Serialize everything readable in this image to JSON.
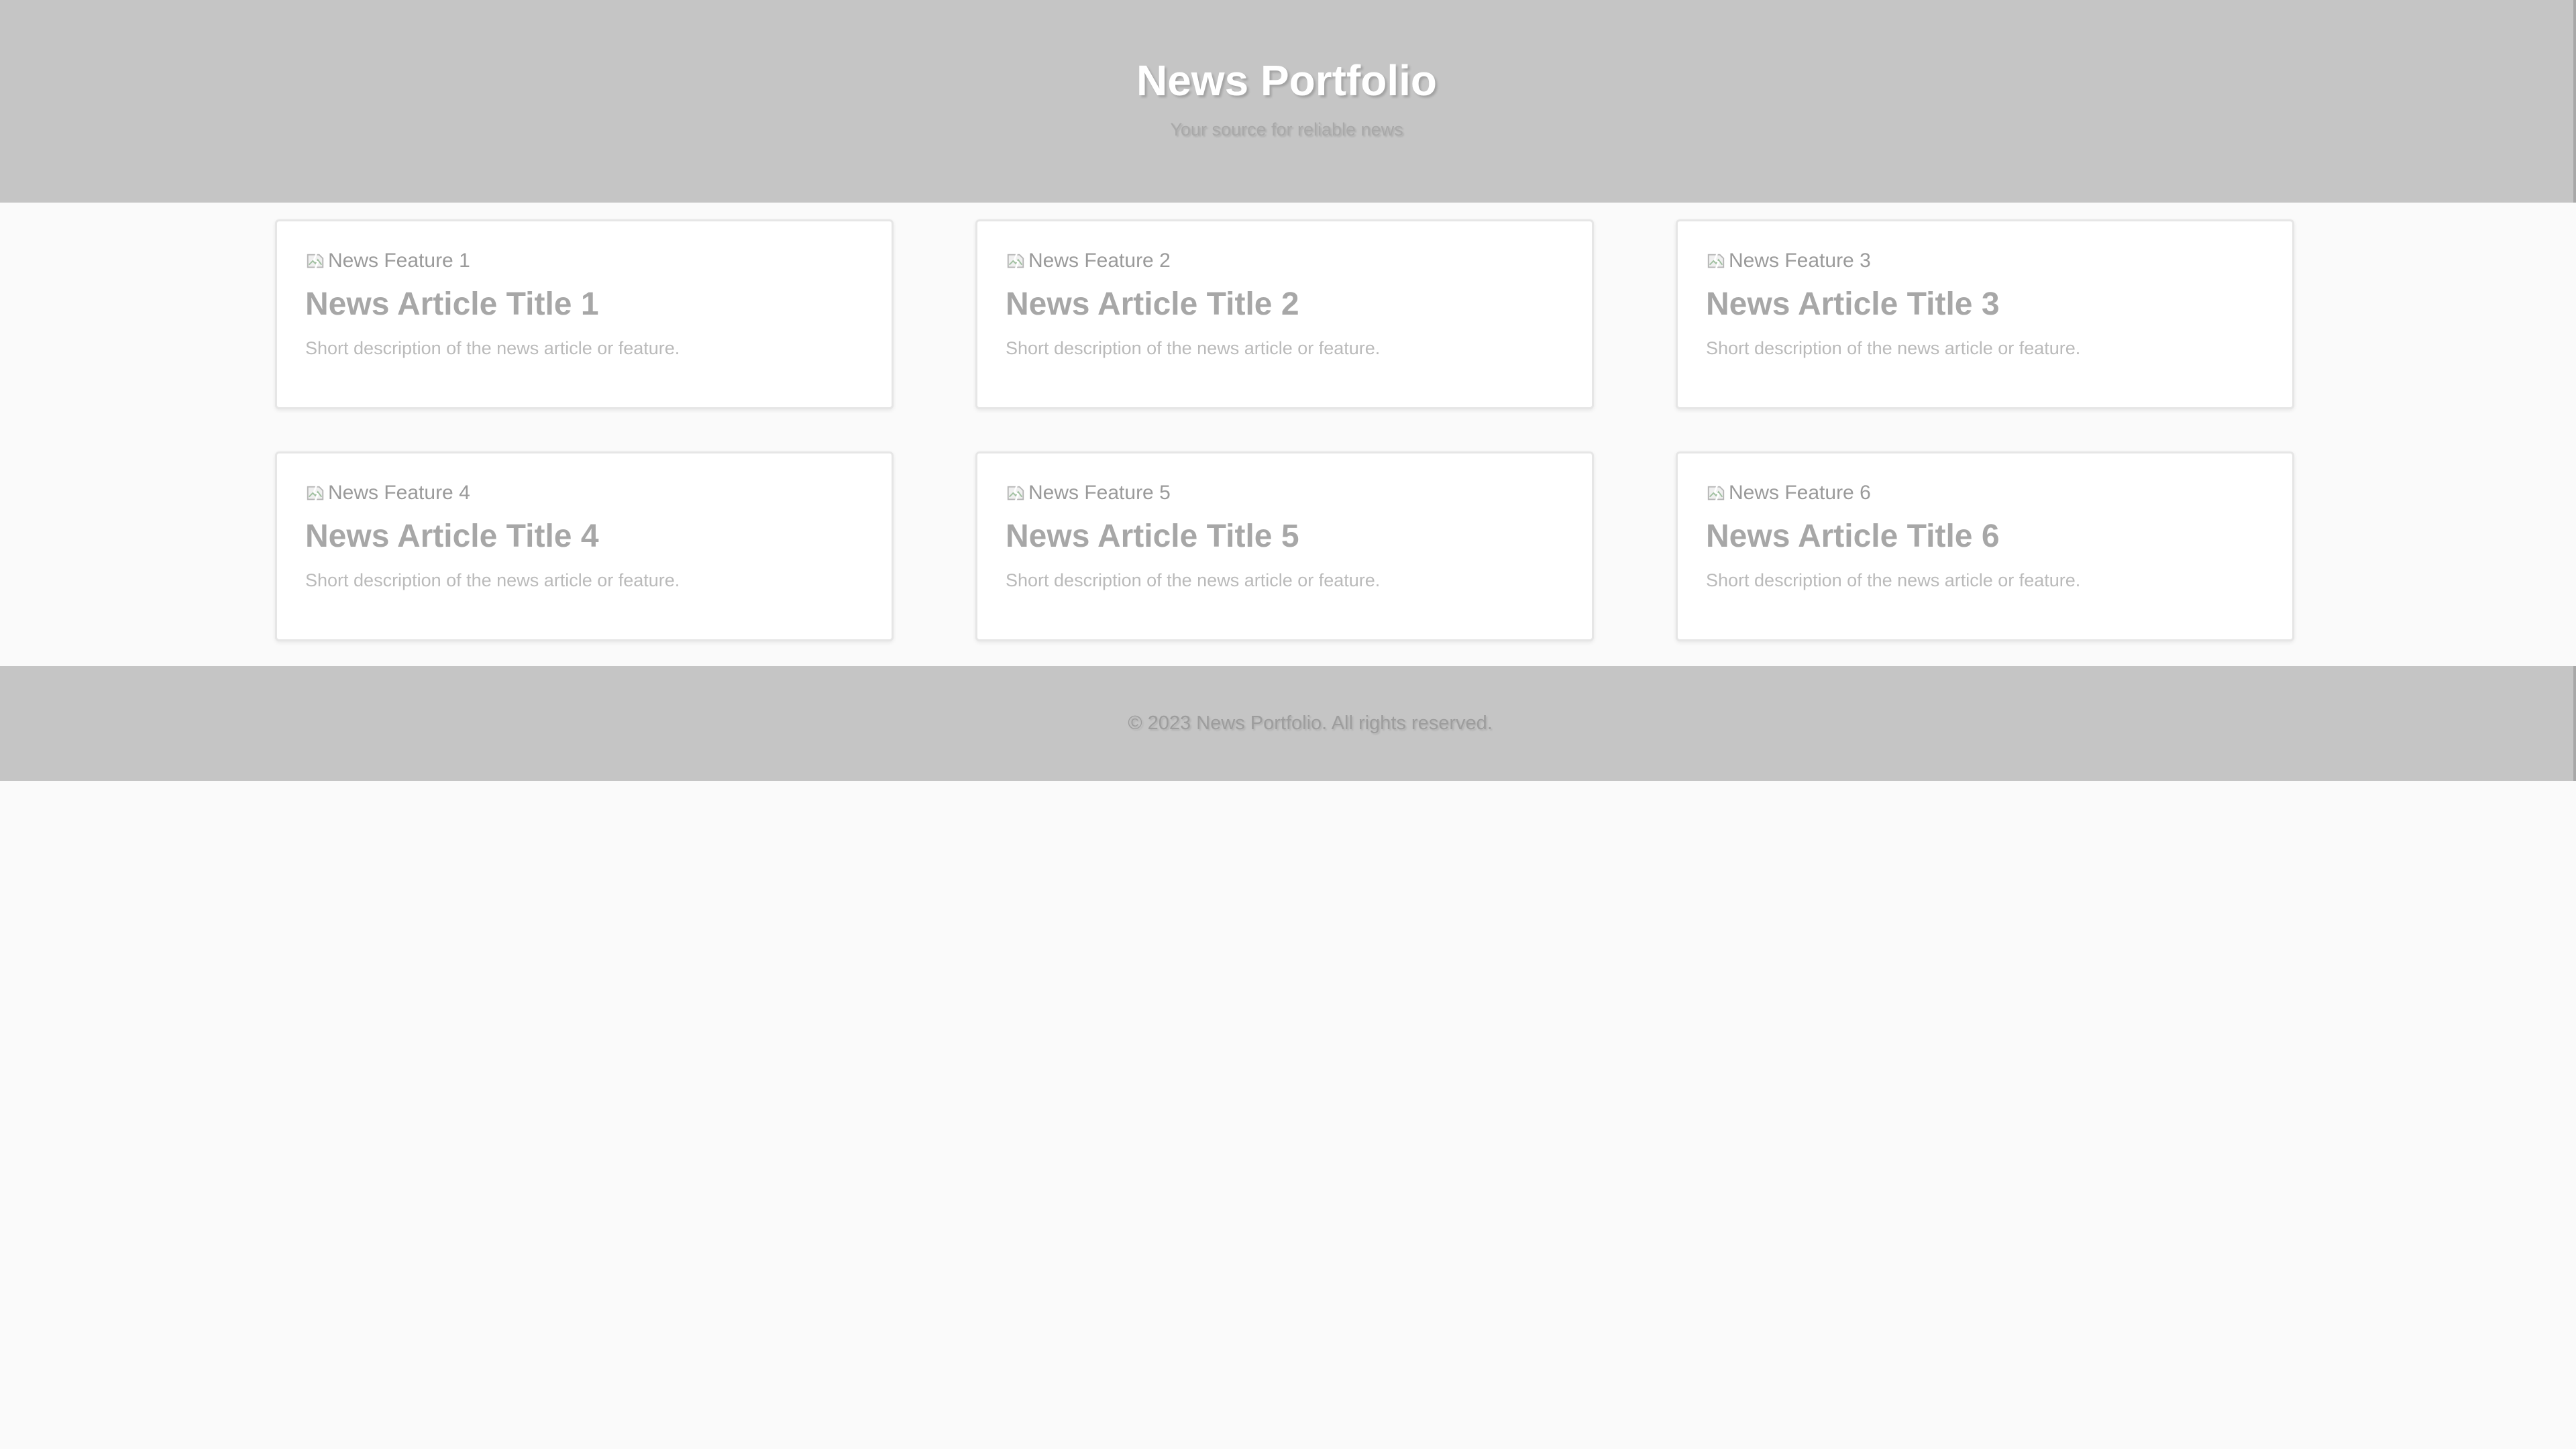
{
  "header": {
    "title": "News Portfolio",
    "subtitle": "Your source for reliable news"
  },
  "articles": [
    {
      "image_alt": "News Feature 1",
      "title": "News Article Title 1",
      "description": "Short description of the news article or feature."
    },
    {
      "image_alt": "News Feature 2",
      "title": "News Article Title 2",
      "description": "Short description of the news article or feature."
    },
    {
      "image_alt": "News Feature 3",
      "title": "News Article Title 3",
      "description": "Short description of the news article or feature."
    },
    {
      "image_alt": "News Feature 4",
      "title": "News Article Title 4",
      "description": "Short description of the news article or feature."
    },
    {
      "image_alt": "News Feature 5",
      "title": "News Article Title 5",
      "description": "Short description of the news article or feature."
    },
    {
      "image_alt": "News Feature 6",
      "title": "News Article Title 6",
      "description": "Short description of the news article or feature."
    }
  ],
  "footer": {
    "copyright": "© 2023 News Portfolio. All rights reserved."
  },
  "icons": {
    "article_image": "broken-image-icon"
  },
  "colors": {
    "header_bg": "#c5c5c5",
    "footer_bg": "#c5c5c5",
    "page_bg": "#fafafa",
    "card_bg": "#ffffff"
  }
}
